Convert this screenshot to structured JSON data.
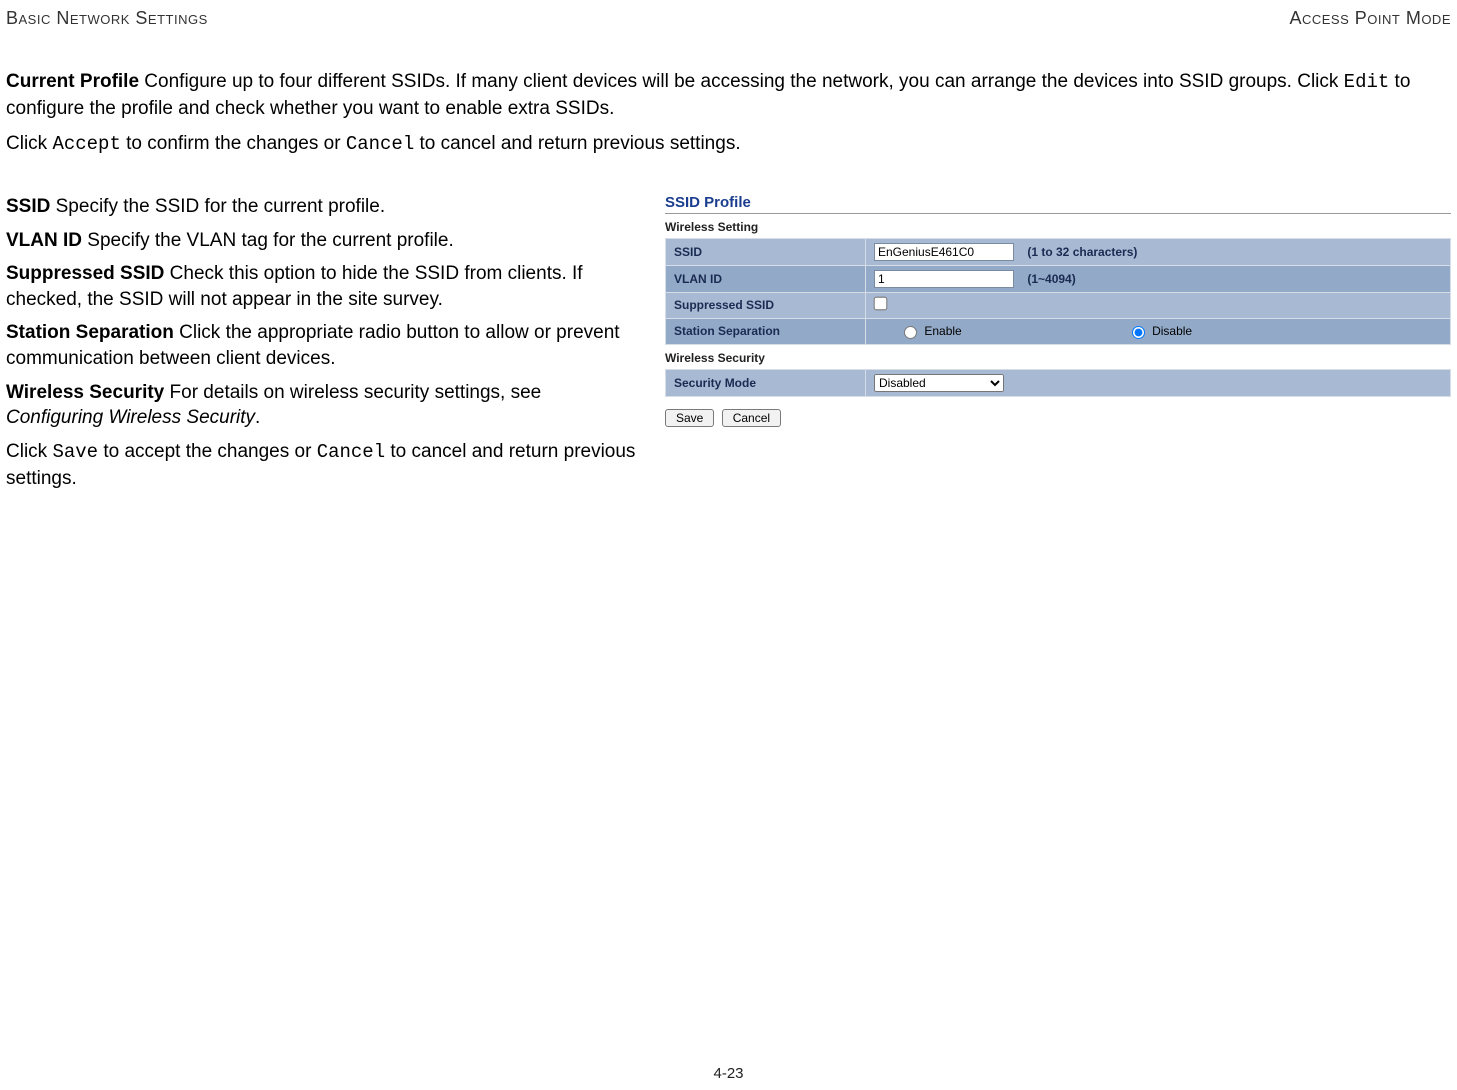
{
  "header": {
    "left": "Basic Network Settings",
    "right": "Access Point Mode"
  },
  "intro": {
    "label": "Current Profile",
    "text_before_edit": "  Configure up to four different SSIDs. If many client devices will be accessing the network, you can arrange the devices into SSID groups. Click ",
    "edit": "Edit",
    "text_after_edit": " to configure the profile and check whether you want to enable extra SSIDs."
  },
  "intro2": {
    "pre": "Click ",
    "accept": "Accept",
    "mid": " to confirm the changes or ",
    "cancel": "Cancel",
    "post": " to cancel and return previous settings."
  },
  "left_defs": {
    "ssid_label": "SSID",
    "ssid_text": "  Specify the SSID for the current profile.",
    "vlan_label": "VLAN ID",
    "vlan_text": "  Specify the VLAN tag for the current profile.",
    "sup_label": "Suppressed SSID",
    "sup_text": "  Check this option to hide the SSID from clients. If checked, the SSID will not appear in the site survey.",
    "sep_label": "Station Separation",
    "sep_text": "  Click the appropriate radio button to allow or prevent communication between client devices.",
    "sec_label": "Wireless Security",
    "sec_text_pre": "  For details on wireless security settings, see ",
    "sec_text_em": "Configuring Wireless Security",
    "sec_text_post": ".",
    "save_pre": "Click ",
    "save": "Save",
    "save_mid": " to accept the changes or ",
    "cancel": "Cancel",
    "save_post": " to cancel and return previous settings."
  },
  "panel": {
    "title": "SSID Profile",
    "section_wireless_setting": "Wireless Setting",
    "section_wireless_security": "Wireless Security",
    "rows": {
      "ssid_label": "SSID",
      "ssid_value": "EnGeniusE461C0",
      "ssid_hint": "(1 to 32 characters)",
      "vlan_label": "VLAN ID",
      "vlan_value": "1",
      "vlan_hint": "(1~4094)",
      "sup_label": "Suppressed SSID",
      "sep_label": "Station Separation",
      "sep_enable": "Enable",
      "sep_disable": "Disable",
      "secmode_label": "Security Mode",
      "secmode_value": "Disabled"
    },
    "buttons": {
      "save": "Save",
      "cancel": "Cancel"
    }
  },
  "page_number": "4-23"
}
